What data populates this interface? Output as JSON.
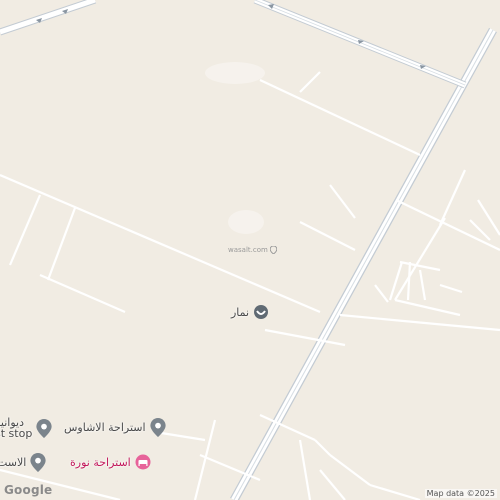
{
  "map": {
    "watermark": "wasalt.com",
    "watermark_icon": "location-pin-icon",
    "logo": "Google",
    "attribution": "Map data ©2025",
    "colors": {
      "land": "#f1ece3",
      "road": "#ffffff",
      "road_edge": "#c9d1d9",
      "highway": "#b9c3cc"
    },
    "pois": [
      {
        "label": "نمار",
        "icon": "location-pin-icon",
        "style": "grey"
      },
      {
        "label": "استراحة الاشاوس",
        "icon": "location-pin-icon",
        "style": "grey"
      },
      {
        "label": "استراحة نورة",
        "icon": "lodging-icon",
        "style": "pink"
      },
      {
        "label": "ديوانية",
        "icon": "location-pin-icon",
        "style": "grey"
      },
      {
        "label": "st stop",
        "icon": "",
        "style": "grey"
      },
      {
        "label": "الاست",
        "icon": "location-pin-icon",
        "style": "grey"
      }
    ]
  }
}
